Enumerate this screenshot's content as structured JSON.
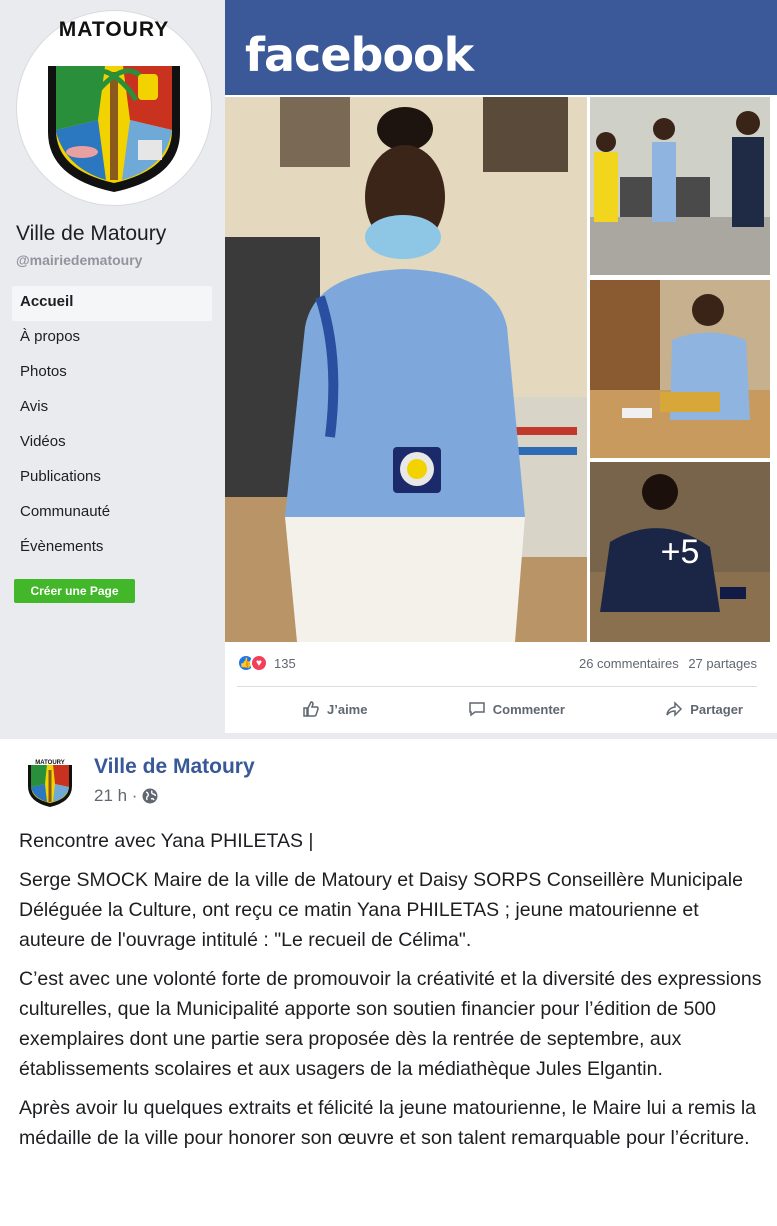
{
  "sidebar": {
    "page_name": "Ville de Matoury",
    "handle": "@mairiedematoury",
    "logo_text": "MATOURY",
    "nav": [
      "Accueil",
      "À propos",
      "Photos",
      "Avis",
      "Vidéos",
      "Publications",
      "Communauté",
      "Évènements"
    ],
    "create_page": "Créer une Page"
  },
  "header": {
    "wordmark": "facebook"
  },
  "photos": {
    "more_count": "+5"
  },
  "engagement": {
    "reactions": "135",
    "comments": "26 commentaires",
    "shares": "27 partages",
    "like_label": "J’aime",
    "comment_label": "Commenter",
    "share_label": "Partager"
  },
  "post": {
    "author": "Ville de Matoury",
    "time": "21 h ·",
    "paragraphs": [
      "Rencontre avec Yana PHILETAS |",
      "Serge SMOCK Maire de la ville de Matoury et Daisy SORPS Conseillère Municipale Déléguée la Culture, ont reçu ce matin Yana PHILETAS ; jeune matourienne et auteure de l'ouvrage intitulé : \"Le recueil de Célima\".",
      "C’est avec une volonté forte de promouvoir la créativité et la diversité des expressions culturelles, que la Municipalité apporte son soutien financier pour l’édition de 500 exemplaires dont une partie sera proposée dès la rentrée de septembre, aux établissements scolaires et aux usagers de la médiathèque Jules Elgantin.",
      "Après avoir lu quelques extraits et félicité la jeune matourienne, le Maire lui a remis la médaille de la ville pour honorer son œuvre et son talent remarquable pour l’écriture."
    ]
  },
  "colors": {
    "facebook_blue": "#3b5998",
    "link_blue": "#385898",
    "create_green": "#42b72a",
    "sidebar_bg": "#e9ebee"
  }
}
